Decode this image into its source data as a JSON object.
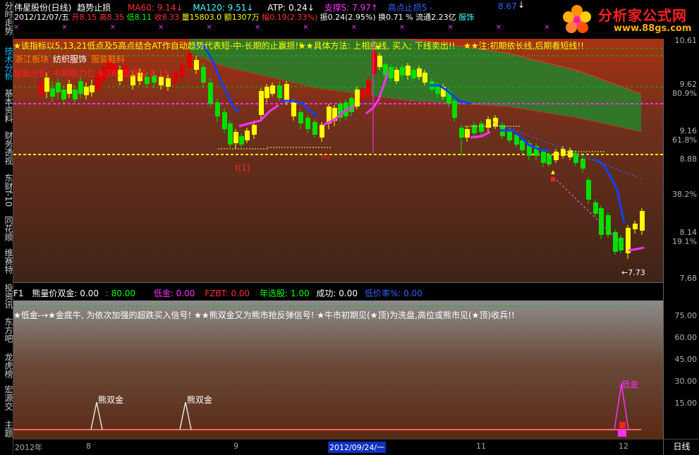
{
  "sidebar": {
    "tabs": [
      "分时走势",
      "技术分析",
      "基本资料",
      "财务透视",
      "东财f-10",
      "同花顺",
      "维赛特",
      "投资讯",
      "东方吧",
      "龙虎榜",
      "宏源交",
      "主题"
    ]
  },
  "header": {
    "stock": "伟星股份(日线)",
    "indicator": "趋势止损",
    "ma60_label": "MA60: 9.14",
    "ma120_label": "MA120: 9.51",
    "atp_label": "ATP: 0.24",
    "support_label": "支撑S: 7.97",
    "high_stop_label": "高点止损5 -",
    "extra_value": "8.67",
    "row2": {
      "date": "2012/12/07/五",
      "open": "开8.15",
      "high": "高8.35",
      "low": "低8.11",
      "close": "收8.33",
      "volume": "量15803.0",
      "amount": "额1307万",
      "change": "幅0.19(2.33%)",
      "amplitude": "振0.24(2.95%)",
      "turnover": "换0.71 %",
      "float_cap": "流通2.23亿",
      "industry": "服饰"
    }
  },
  "logo": {
    "name": "分析家公式网",
    "url": "www.88gs.com"
  },
  "main_chart": {
    "notice1": "★该指标以5,13,21低点及5高点结合AT作自动趋势代表短-中-长期的止赢损!!",
    "notice2": "★★具体方法: 上相应线, 买入; 下线卖出!!",
    "notice3": "★★注:初期依长线,后期看短线!!",
    "tags": [
      "浙江板块",
      "纺织服饰",
      "服装鞋料"
    ],
    "pressure_text": "智能分析: 中期阻力位 9.76, 支撑位 8.15",
    "anno_cn": "t(1)",
    "anno_m": "m",
    "low_label": "←7.73",
    "y_ticks": [
      "10.61",
      "9.62",
      "80.9%",
      "9.16",
      "61.8%",
      "8.88",
      "38.2%",
      "8.14",
      "19.1%",
      "7.68"
    ]
  },
  "sub_chart": {
    "header": {
      "f1": "F1",
      "name": "熊量价双金: 0.00",
      "v80": ": 80.00",
      "low_gold": "低金: 0.00",
      "fzbt": "FZBT: 0.00",
      "annual": "年选股: 1.00",
      "success": "成功: 0.00",
      "rate": "低价率%: 0.00"
    },
    "desc": "★低金-→★金底牛, 为依次加强的超跌买入信号! ★★熊双金又为熊市抢反弹信号! ★牛市初期见(★顶)为洗盘,高位或熊市见(★顶)收兵!!",
    "signals": [
      "熊双金",
      "熊双金",
      "低金"
    ],
    "y_ticks": [
      "75.00",
      "60.00",
      "45.00",
      "30.00",
      "15.00"
    ]
  },
  "timeline": {
    "dates": [
      "2012年",
      "8",
      "9",
      "2012/09/24/一",
      "11",
      "12"
    ],
    "period": "日线"
  },
  "colors": {
    "up": "#ffff00",
    "down": "#00ff00",
    "ma60": "#ff3030",
    "ma120": "#40ffff",
    "support_line": "#ffff00",
    "pressure_line": "#ff30ff"
  }
}
